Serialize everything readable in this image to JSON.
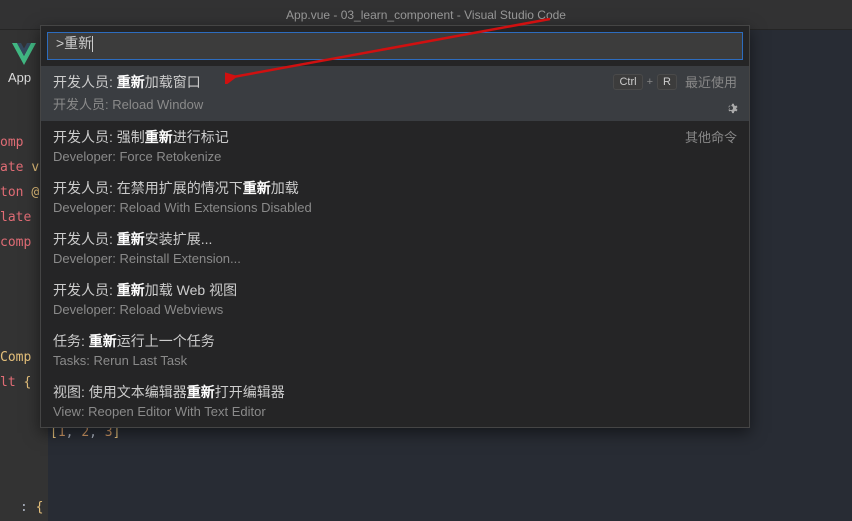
{
  "title": "App.vue - 03_learn_component - Visual Studio Code",
  "tabLabel": "App",
  "palette": {
    "input_value": ">重新",
    "items": [
      {
        "l1_pre": "开发人员: ",
        "l1_hi": "重新",
        "l1_post": "加载窗口",
        "l2": "开发人员: Reload Window",
        "key1": "Ctrl",
        "key2": "R",
        "group": "最近使用"
      },
      {
        "l1_pre": "开发人员: 强制",
        "l1_hi": "重新",
        "l1_post": "进行标记",
        "l2": "Developer: Force Retokenize",
        "group": "其他命令"
      },
      {
        "l1_pre": "开发人员: 在禁用扩展的情况下",
        "l1_hi": "重新",
        "l1_post": "加载",
        "l2": "Developer: Reload With Extensions Disabled"
      },
      {
        "l1_pre": "开发人员: ",
        "l1_hi": "重新",
        "l1_post": "安装扩展...",
        "l2": "Developer: Reinstall Extension..."
      },
      {
        "l1_pre": "开发人员: ",
        "l1_hi": "重新",
        "l1_post": "加载 Web 视图",
        "l2": "Developer: Reload Webviews"
      },
      {
        "l1_pre": "任务: ",
        "l1_hi": "重新",
        "l1_post": "运行上一个任务",
        "l2": "Tasks: Rerun Last Task"
      },
      {
        "l1_pre": "视图: 使用文本编辑器",
        "l1_hi": "重新",
        "l1_post": "打开编辑器",
        "l2": "View: Reopen Editor With Text Editor"
      }
    ]
  },
  "code": {
    "frag1": "omp",
    "frag2a": "ate ",
    "frag2b": "v",
    "frag3a": "ton ",
    "frag3b": "@",
    "frag4": "late",
    "frag5": "comp",
    "frag6": "Comp",
    "frag7a": "lt ",
    "frag7b": "{",
    "frag8a": "[",
    "frag8b": "1",
    "frag8c": ", ",
    "frag8d": "2",
    "frag8e": ", ",
    "frag8f": "3",
    "frag8g": "]",
    "frag9a": ": ",
    "frag9b": "{"
  }
}
